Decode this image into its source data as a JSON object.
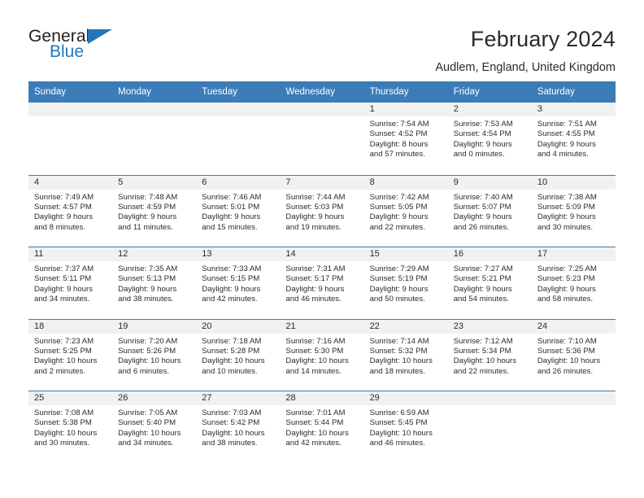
{
  "brand": {
    "name_top": "General",
    "name_bottom": "Blue",
    "triangle_color": "#2275bb"
  },
  "header": {
    "title": "February 2024",
    "subtitle": "Audlem, England, United Kingdom"
  },
  "theme": {
    "header_blue": "#3b7cb8",
    "day_band_gray": "#f1f1f1",
    "text": "#2b2b2b"
  },
  "calendar": {
    "day_headers": [
      "Sunday",
      "Monday",
      "Tuesday",
      "Wednesday",
      "Thursday",
      "Friday",
      "Saturday"
    ],
    "weeks": [
      [
        {
          "day": "",
          "empty": true
        },
        {
          "day": "",
          "empty": true
        },
        {
          "day": "",
          "empty": true
        },
        {
          "day": "",
          "empty": true
        },
        {
          "day": "1",
          "sunrise": "Sunrise: 7:54 AM",
          "sunset": "Sunset: 4:52 PM",
          "daylight_line1": "Daylight: 8 hours",
          "daylight_line2": "and 57 minutes."
        },
        {
          "day": "2",
          "sunrise": "Sunrise: 7:53 AM",
          "sunset": "Sunset: 4:54 PM",
          "daylight_line1": "Daylight: 9 hours",
          "daylight_line2": "and 0 minutes."
        },
        {
          "day": "3",
          "sunrise": "Sunrise: 7:51 AM",
          "sunset": "Sunset: 4:55 PM",
          "daylight_line1": "Daylight: 9 hours",
          "daylight_line2": "and 4 minutes."
        }
      ],
      [
        {
          "day": "4",
          "sunrise": "Sunrise: 7:49 AM",
          "sunset": "Sunset: 4:57 PM",
          "daylight_line1": "Daylight: 9 hours",
          "daylight_line2": "and 8 minutes."
        },
        {
          "day": "5",
          "sunrise": "Sunrise: 7:48 AM",
          "sunset": "Sunset: 4:59 PM",
          "daylight_line1": "Daylight: 9 hours",
          "daylight_line2": "and 11 minutes."
        },
        {
          "day": "6",
          "sunrise": "Sunrise: 7:46 AM",
          "sunset": "Sunset: 5:01 PM",
          "daylight_line1": "Daylight: 9 hours",
          "daylight_line2": "and 15 minutes."
        },
        {
          "day": "7",
          "sunrise": "Sunrise: 7:44 AM",
          "sunset": "Sunset: 5:03 PM",
          "daylight_line1": "Daylight: 9 hours",
          "daylight_line2": "and 19 minutes."
        },
        {
          "day": "8",
          "sunrise": "Sunrise: 7:42 AM",
          "sunset": "Sunset: 5:05 PM",
          "daylight_line1": "Daylight: 9 hours",
          "daylight_line2": "and 22 minutes."
        },
        {
          "day": "9",
          "sunrise": "Sunrise: 7:40 AM",
          "sunset": "Sunset: 5:07 PM",
          "daylight_line1": "Daylight: 9 hours",
          "daylight_line2": "and 26 minutes."
        },
        {
          "day": "10",
          "sunrise": "Sunrise: 7:38 AM",
          "sunset": "Sunset: 5:09 PM",
          "daylight_line1": "Daylight: 9 hours",
          "daylight_line2": "and 30 minutes."
        }
      ],
      [
        {
          "day": "11",
          "sunrise": "Sunrise: 7:37 AM",
          "sunset": "Sunset: 5:11 PM",
          "daylight_line1": "Daylight: 9 hours",
          "daylight_line2": "and 34 minutes."
        },
        {
          "day": "12",
          "sunrise": "Sunrise: 7:35 AM",
          "sunset": "Sunset: 5:13 PM",
          "daylight_line1": "Daylight: 9 hours",
          "daylight_line2": "and 38 minutes."
        },
        {
          "day": "13",
          "sunrise": "Sunrise: 7:33 AM",
          "sunset": "Sunset: 5:15 PM",
          "daylight_line1": "Daylight: 9 hours",
          "daylight_line2": "and 42 minutes."
        },
        {
          "day": "14",
          "sunrise": "Sunrise: 7:31 AM",
          "sunset": "Sunset: 5:17 PM",
          "daylight_line1": "Daylight: 9 hours",
          "daylight_line2": "and 46 minutes."
        },
        {
          "day": "15",
          "sunrise": "Sunrise: 7:29 AM",
          "sunset": "Sunset: 5:19 PM",
          "daylight_line1": "Daylight: 9 hours",
          "daylight_line2": "and 50 minutes."
        },
        {
          "day": "16",
          "sunrise": "Sunrise: 7:27 AM",
          "sunset": "Sunset: 5:21 PM",
          "daylight_line1": "Daylight: 9 hours",
          "daylight_line2": "and 54 minutes."
        },
        {
          "day": "17",
          "sunrise": "Sunrise: 7:25 AM",
          "sunset": "Sunset: 5:23 PM",
          "daylight_line1": "Daylight: 9 hours",
          "daylight_line2": "and 58 minutes."
        }
      ],
      [
        {
          "day": "18",
          "sunrise": "Sunrise: 7:23 AM",
          "sunset": "Sunset: 5:25 PM",
          "daylight_line1": "Daylight: 10 hours",
          "daylight_line2": "and 2 minutes."
        },
        {
          "day": "19",
          "sunrise": "Sunrise: 7:20 AM",
          "sunset": "Sunset: 5:26 PM",
          "daylight_line1": "Daylight: 10 hours",
          "daylight_line2": "and 6 minutes."
        },
        {
          "day": "20",
          "sunrise": "Sunrise: 7:18 AM",
          "sunset": "Sunset: 5:28 PM",
          "daylight_line1": "Daylight: 10 hours",
          "daylight_line2": "and 10 minutes."
        },
        {
          "day": "21",
          "sunrise": "Sunrise: 7:16 AM",
          "sunset": "Sunset: 5:30 PM",
          "daylight_line1": "Daylight: 10 hours",
          "daylight_line2": "and 14 minutes."
        },
        {
          "day": "22",
          "sunrise": "Sunrise: 7:14 AM",
          "sunset": "Sunset: 5:32 PM",
          "daylight_line1": "Daylight: 10 hours",
          "daylight_line2": "and 18 minutes."
        },
        {
          "day": "23",
          "sunrise": "Sunrise: 7:12 AM",
          "sunset": "Sunset: 5:34 PM",
          "daylight_line1": "Daylight: 10 hours",
          "daylight_line2": "and 22 minutes."
        },
        {
          "day": "24",
          "sunrise": "Sunrise: 7:10 AM",
          "sunset": "Sunset: 5:36 PM",
          "daylight_line1": "Daylight: 10 hours",
          "daylight_line2": "and 26 minutes."
        }
      ],
      [
        {
          "day": "25",
          "sunrise": "Sunrise: 7:08 AM",
          "sunset": "Sunset: 5:38 PM",
          "daylight_line1": "Daylight: 10 hours",
          "daylight_line2": "and 30 minutes."
        },
        {
          "day": "26",
          "sunrise": "Sunrise: 7:05 AM",
          "sunset": "Sunset: 5:40 PM",
          "daylight_line1": "Daylight: 10 hours",
          "daylight_line2": "and 34 minutes."
        },
        {
          "day": "27",
          "sunrise": "Sunrise: 7:03 AM",
          "sunset": "Sunset: 5:42 PM",
          "daylight_line1": "Daylight: 10 hours",
          "daylight_line2": "and 38 minutes."
        },
        {
          "day": "28",
          "sunrise": "Sunrise: 7:01 AM",
          "sunset": "Sunset: 5:44 PM",
          "daylight_line1": "Daylight: 10 hours",
          "daylight_line2": "and 42 minutes."
        },
        {
          "day": "29",
          "sunrise": "Sunrise: 6:59 AM",
          "sunset": "Sunset: 5:45 PM",
          "daylight_line1": "Daylight: 10 hours",
          "daylight_line2": "and 46 minutes."
        },
        {
          "day": "",
          "empty": true
        },
        {
          "day": "",
          "empty": true
        }
      ]
    ]
  }
}
